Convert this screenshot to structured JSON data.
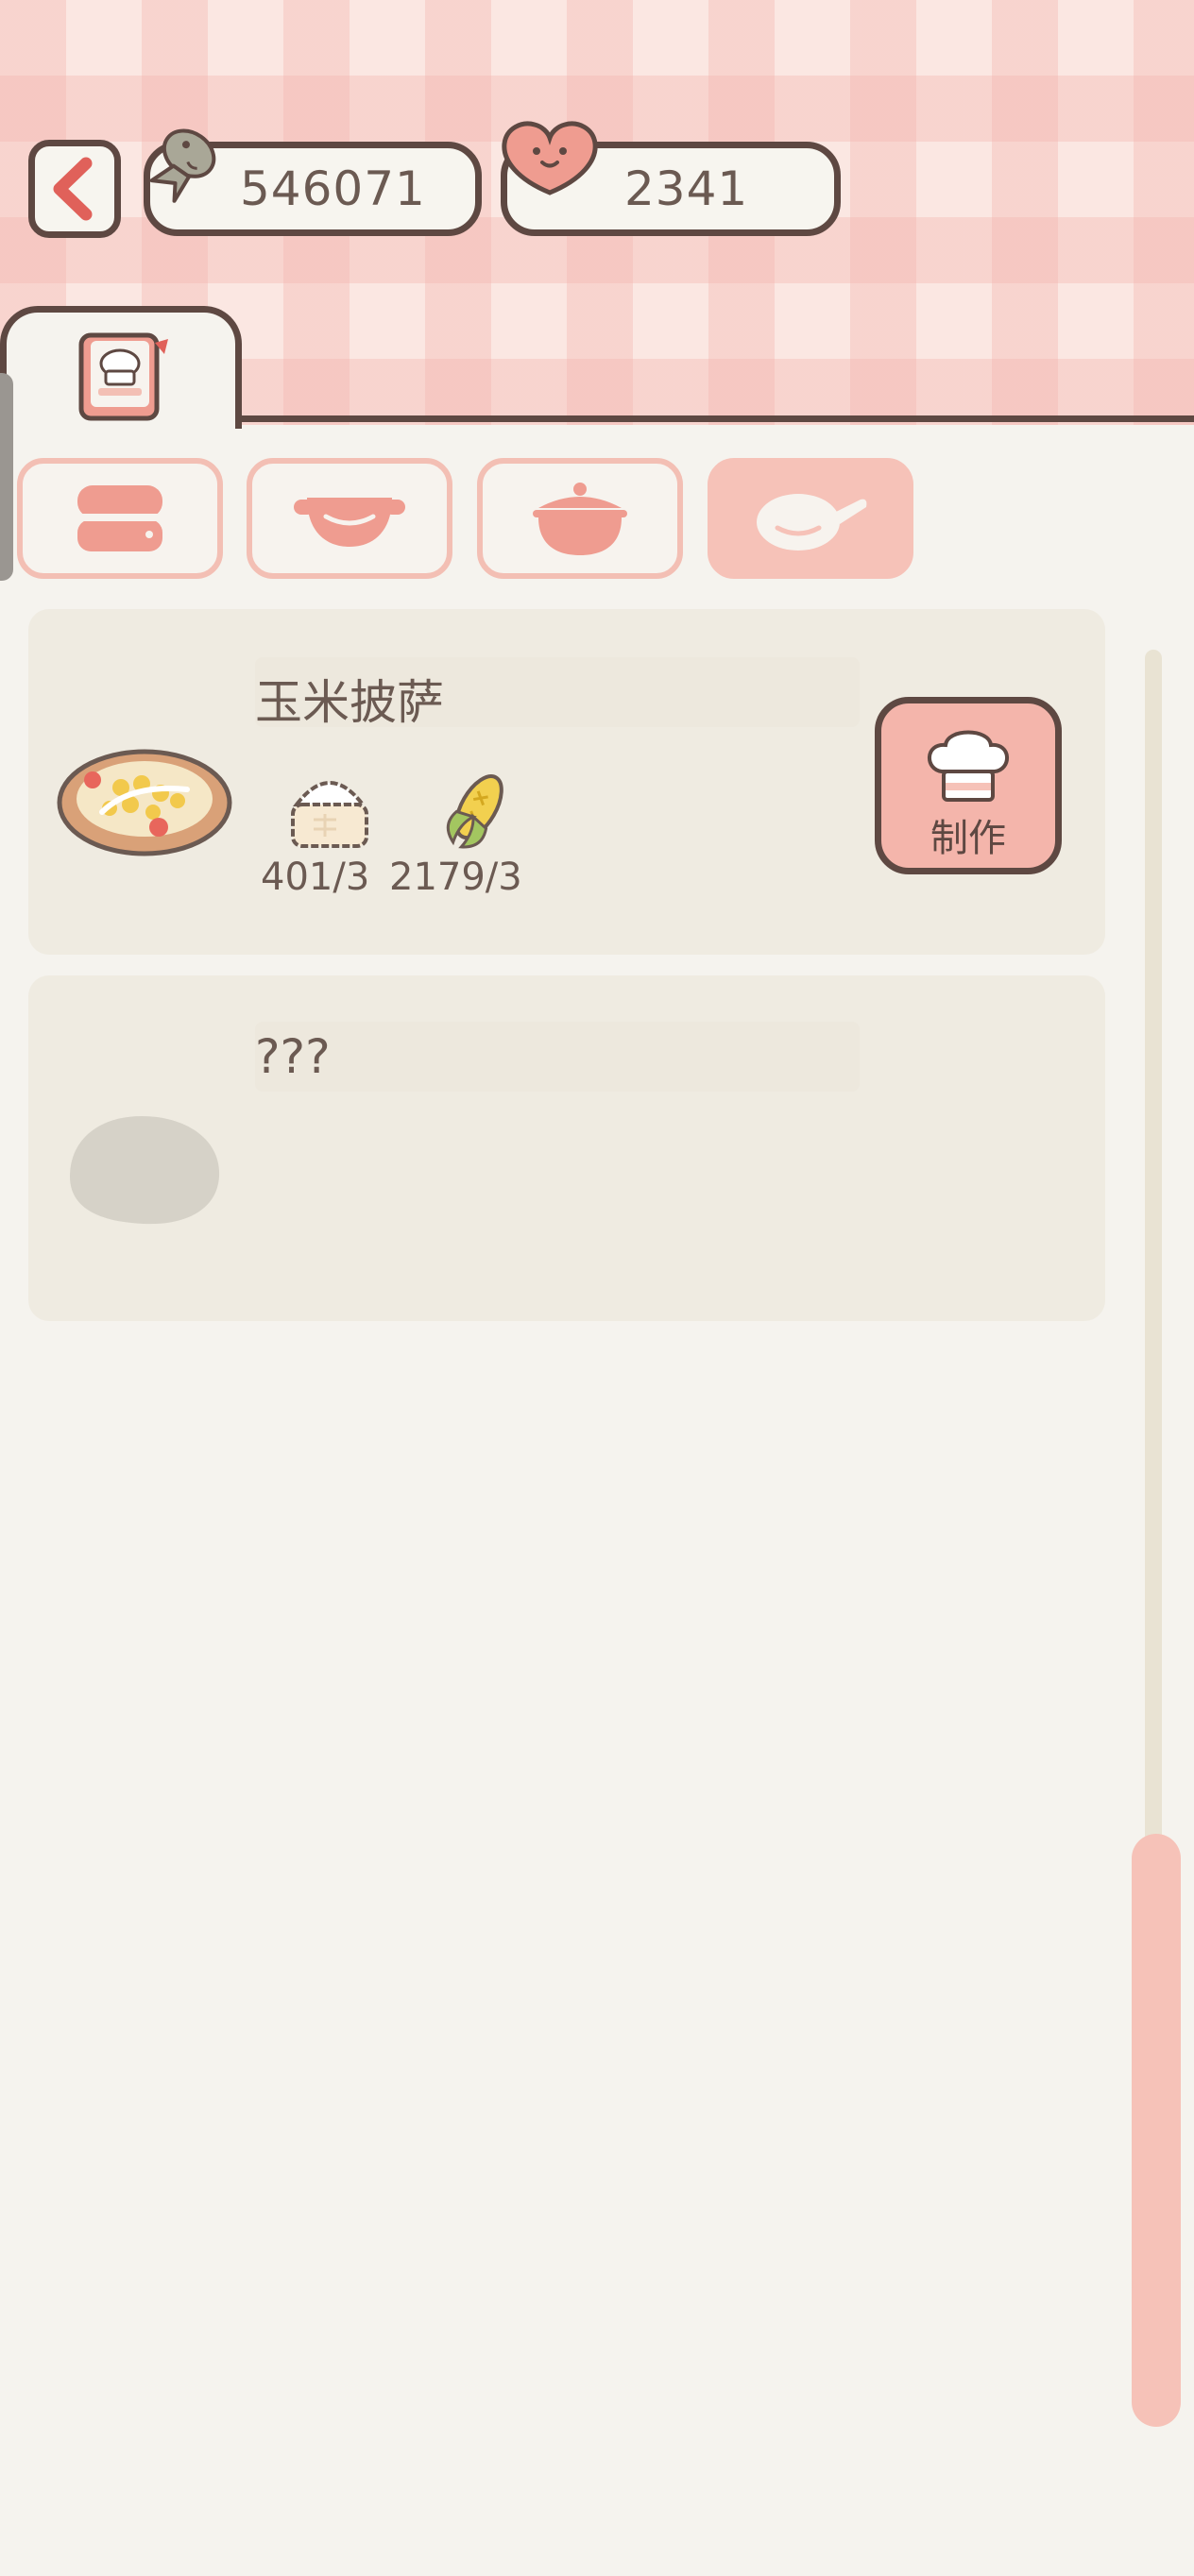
{
  "header": {
    "back_icon": "chevron-left-icon",
    "currencies": [
      {
        "icon": "fish-icon",
        "value": "546071"
      },
      {
        "icon": "heart-face-icon",
        "value": "2341"
      }
    ]
  },
  "tabs": [
    {
      "icon": "recipe-book-icon",
      "active": true
    }
  ],
  "categories": [
    {
      "icon": "steamer-icon",
      "active": false
    },
    {
      "icon": "pot-icon",
      "active": false
    },
    {
      "icon": "casserole-icon",
      "active": false
    },
    {
      "icon": "frying-pan-icon",
      "active": true
    }
  ],
  "recipes": [
    {
      "name": "玉米披萨",
      "dish_icon": "corn-pizza-icon",
      "ingredients": [
        {
          "icon": "flour-icon",
          "count": "401/3"
        },
        {
          "icon": "corn-icon",
          "count": "2179/3"
        }
      ],
      "make_label": "制作",
      "make_icon": "chef-hat-icon"
    },
    {
      "name": "???",
      "dish_icon": "unknown-dish-icon"
    }
  ],
  "colors": {
    "outline": "#5e4842",
    "accent_pink": "#f6c2b8",
    "card_bg": "#efebe1",
    "page_bg": "#f5f3ee"
  }
}
